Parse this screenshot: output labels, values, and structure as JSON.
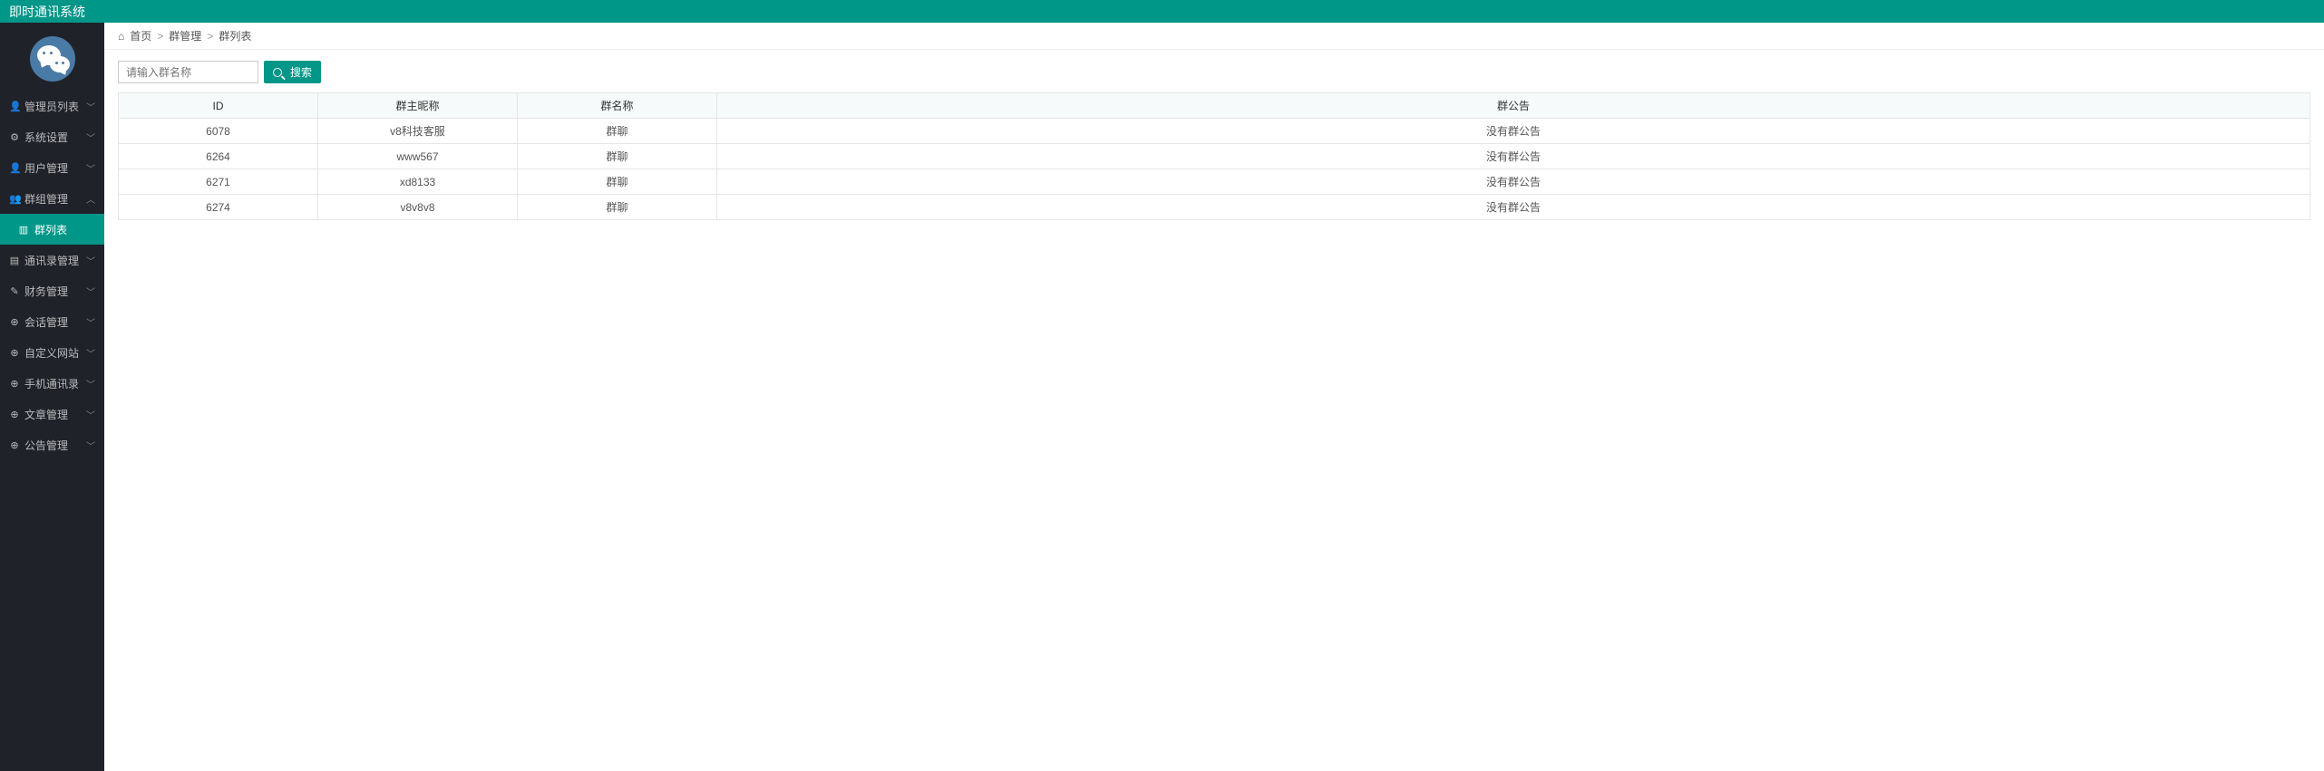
{
  "header": {
    "title": "即时通讯系统"
  },
  "sidebar": {
    "items": [
      {
        "icon": "user",
        "label": "管理员列表",
        "expanded": false
      },
      {
        "icon": "gear",
        "label": "系统设置",
        "expanded": false
      },
      {
        "icon": "user",
        "label": "用户管理",
        "expanded": false
      },
      {
        "icon": "users",
        "label": "群组管理",
        "expanded": true,
        "children": [
          {
            "icon": "list",
            "label": "群列表",
            "active": true
          }
        ]
      },
      {
        "icon": "book",
        "label": "通讯录管理",
        "expanded": false
      },
      {
        "icon": "doc",
        "label": "财务管理",
        "expanded": false
      },
      {
        "icon": "globe",
        "label": "会话管理",
        "expanded": false
      },
      {
        "icon": "globe",
        "label": "自定义网站",
        "expanded": false
      },
      {
        "icon": "globe",
        "label": "手机通讯录",
        "expanded": false
      },
      {
        "icon": "globe",
        "label": "文章管理",
        "expanded": false
      },
      {
        "icon": "globe",
        "label": "公告管理",
        "expanded": false
      }
    ]
  },
  "breadcrumb": {
    "home": "首页",
    "level1": "群管理",
    "level2": "群列表"
  },
  "search": {
    "placeholder": "请输入群名称",
    "button": "搜索"
  },
  "table": {
    "headers": {
      "id": "ID",
      "owner": "群主昵称",
      "name": "群名称",
      "notice": "群公告"
    },
    "rows": [
      {
        "id": "6078",
        "owner": "v8科技客服",
        "name": "群聊",
        "notice": "没有群公告"
      },
      {
        "id": "6264",
        "owner": "www567",
        "name": "群聊",
        "notice": "没有群公告"
      },
      {
        "id": "6271",
        "owner": "xd8133",
        "name": "群聊",
        "notice": "没有群公告"
      },
      {
        "id": "6274",
        "owner": "v8v8v8",
        "name": "群聊",
        "notice": "没有群公告"
      }
    ]
  },
  "icons": {
    "user": "👤",
    "gear": "⚙",
    "users": "👥",
    "book": "▤",
    "doc": "✎",
    "globe": "⊕",
    "list": "▥",
    "home": "⌂"
  }
}
